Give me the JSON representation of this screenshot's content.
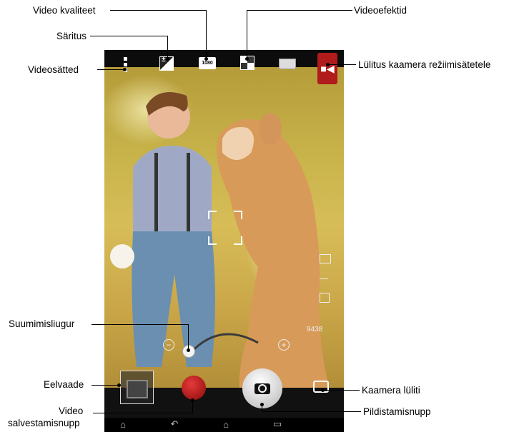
{
  "callouts": {
    "video_quality": "Video kvaliteet",
    "exposure": "Säritus",
    "video_settings": "Videosätted",
    "video_effects": "Videoefektid",
    "switch_camera_mode": "Lülitus kaamera režiimisätetele",
    "zoom_slider": "Suumimisliugur",
    "preview": "Eelvaade",
    "video_record_button_line1": "Video",
    "video_record_button_line2": "salvestamisnupp",
    "camera_switch": "Kaamera lüliti",
    "capture_button": "Pildistamisnupp"
  },
  "screen": {
    "quality_icon_text": "1080",
    "counter_text": "9438",
    "icons": [
      "settings-dots-icon",
      "exposure-icon",
      "video-quality-icon",
      "video-effects-icon",
      "scene-mode-icon",
      "camera-mode-switch-icon",
      "zoom-minus-icon",
      "zoom-plus-icon",
      "gallery-preview-icon",
      "record-icon",
      "shutter-camera-icon",
      "camera-switch-icon",
      "home-nav-icon",
      "back-nav-icon",
      "recent-apps-nav-icon"
    ]
  },
  "colors": {
    "record": "#b01010",
    "mode_switch": "#b01b1b",
    "screen_bg": "#000000"
  }
}
